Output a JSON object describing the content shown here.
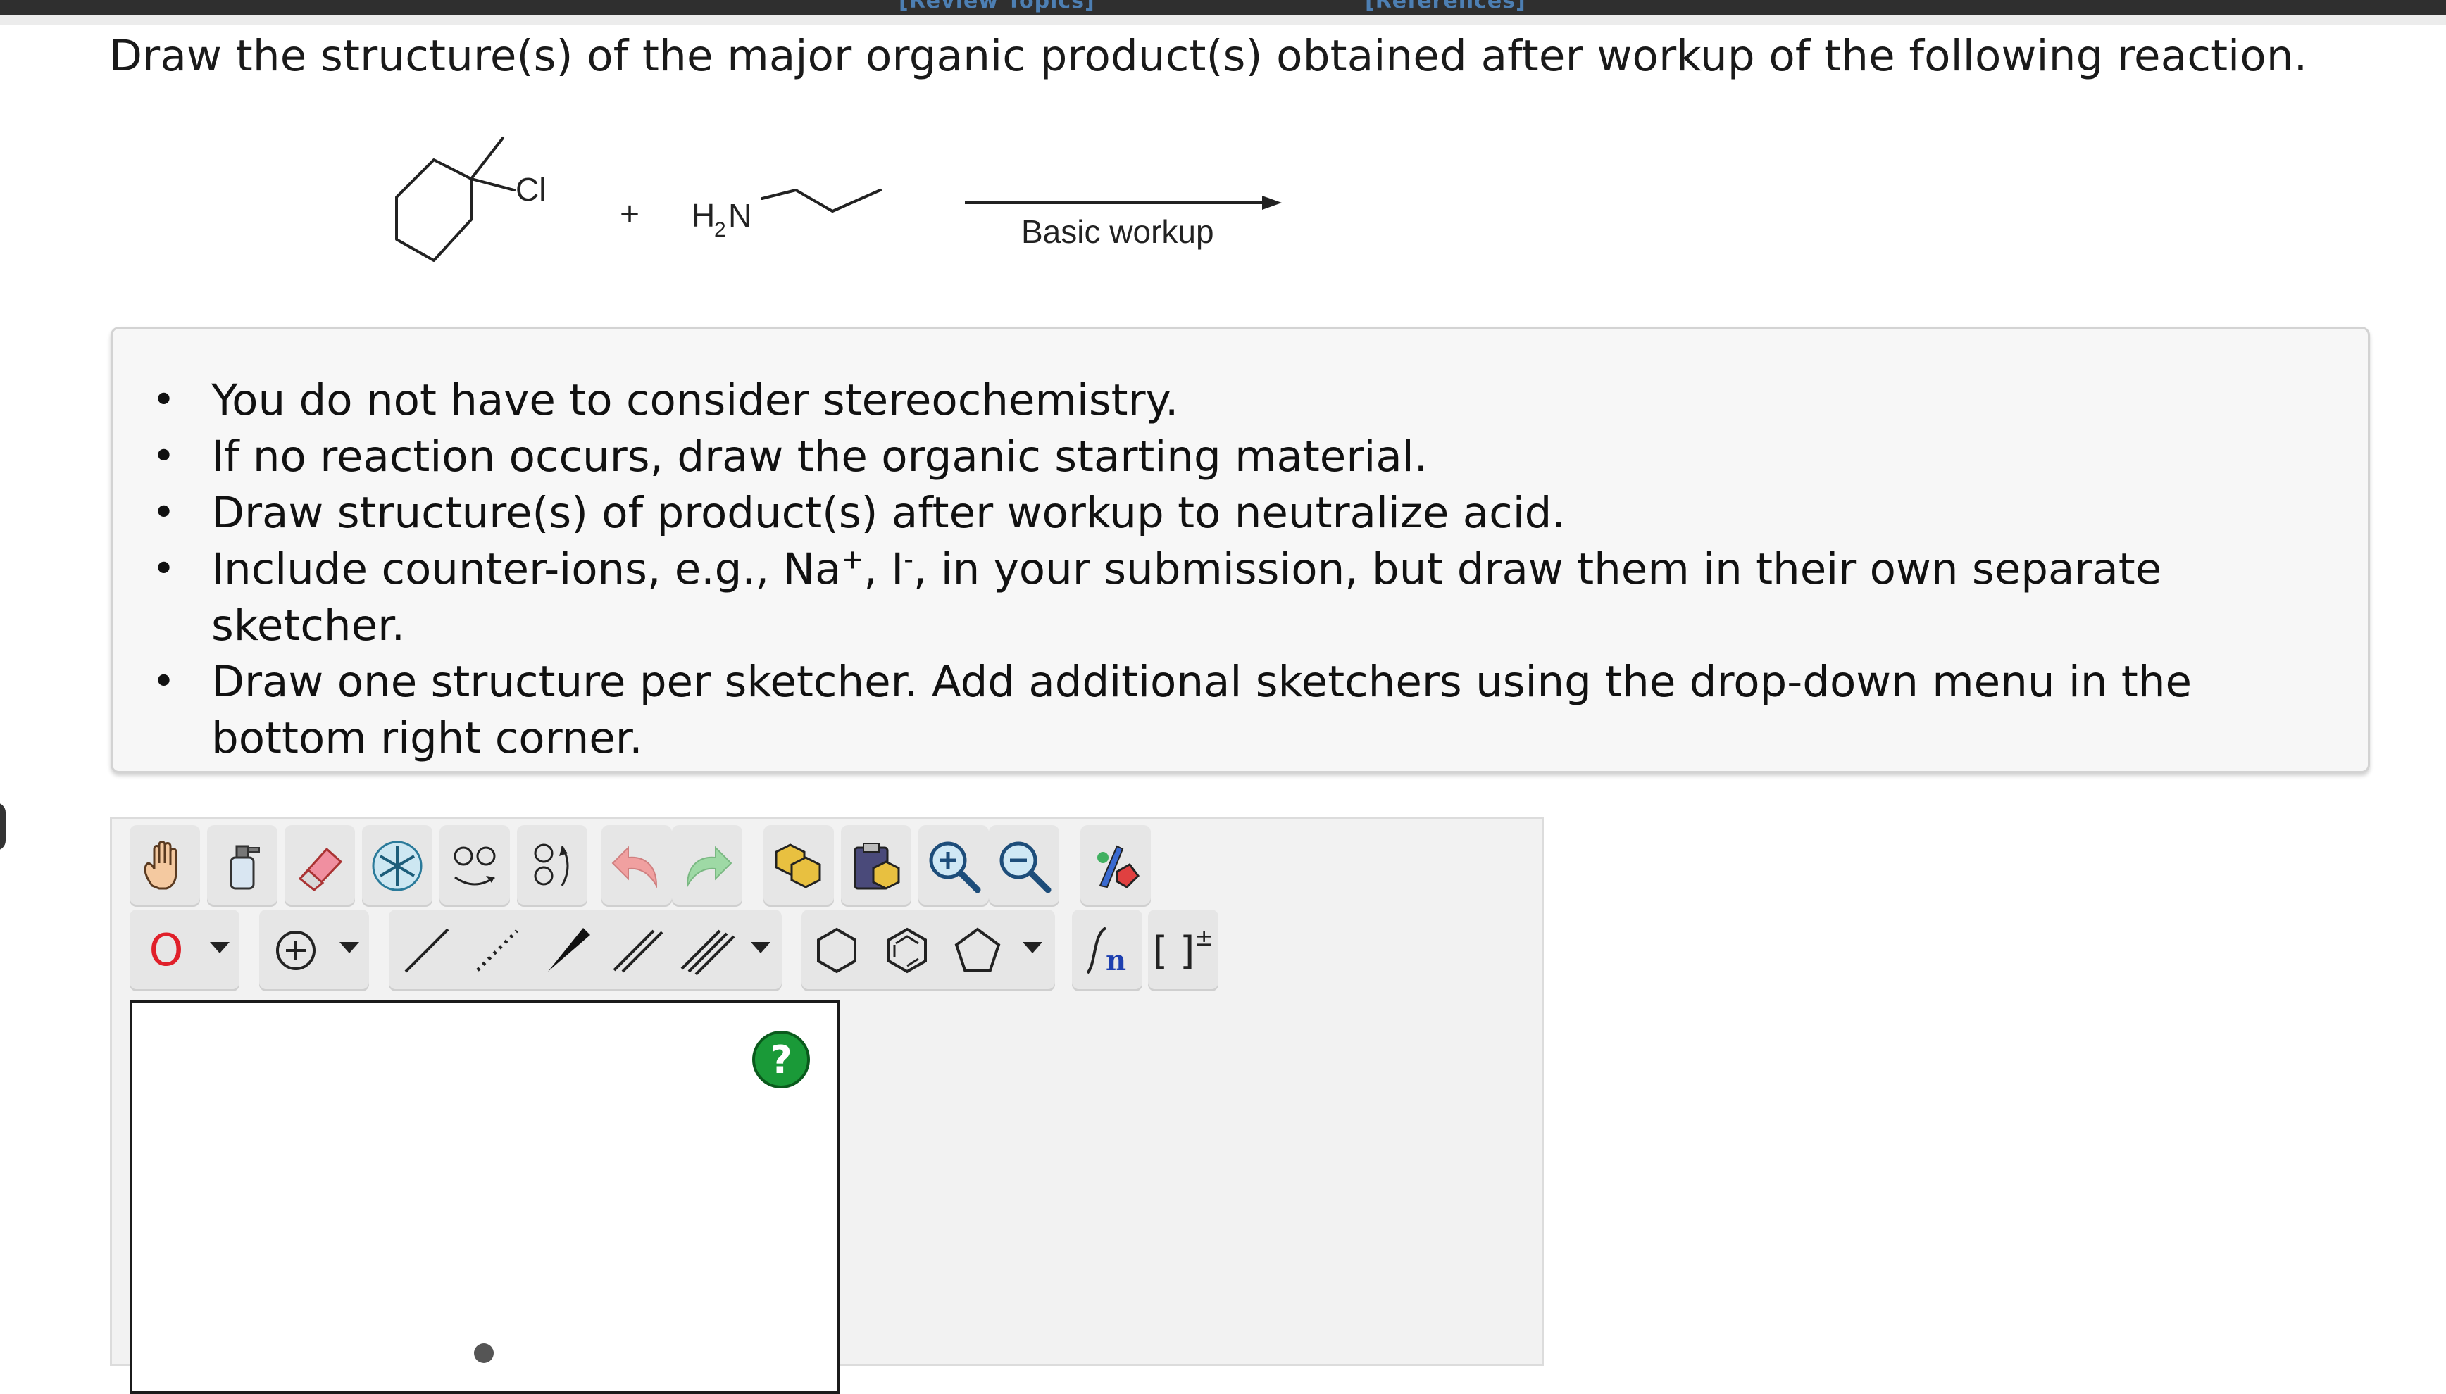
{
  "nav": {
    "review_topics": "[Review Topics]",
    "references": "[References]"
  },
  "question": "Draw the structure(s) of the major organic product(s) obtained after workup of the following reaction.",
  "reaction": {
    "leaving_group": "Cl",
    "plus": "+",
    "amine_h": "H",
    "amine_sub": "2",
    "amine_n": "N",
    "condition": "Basic workup"
  },
  "instructions": {
    "item1": "You do not have to consider stereochemistry.",
    "item2": "If no reaction occurs, draw the organic starting material.",
    "item3": "Draw structure(s) of product(s) after workup to neutralize acid.",
    "item4_a": "Include counter-ions, e.g., Na",
    "item4_sup1": "+",
    "item4_b": ", I",
    "item4_sup2": "-",
    "item4_c": ", in your submission, but draw them in their own separate sketcher.",
    "item5": "Draw one structure per sketcher. Add additional sketchers using the drop-down menu in the bottom right corner."
  },
  "toolbar": {
    "atom_symbol": "O",
    "bracket_label": "[ ]",
    "bracket_sup": "±",
    "sgroup_label": "n",
    "help_label": "?"
  },
  "colors": {
    "accent_red": "#e0202a",
    "help_green": "#1a9a38",
    "link_blue": "#4d7fb3"
  }
}
